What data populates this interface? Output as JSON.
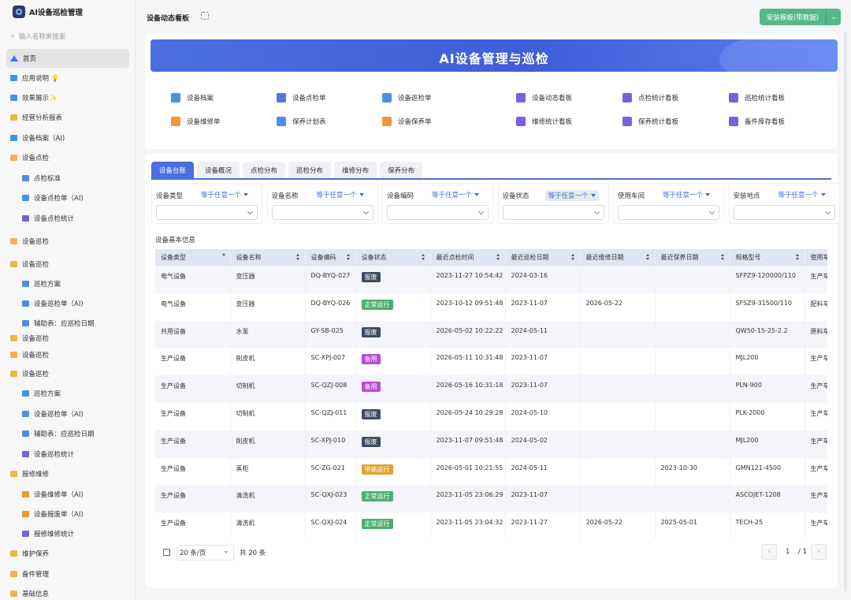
{
  "app": {
    "title": "AI设备巡检管理"
  },
  "search": {
    "placeholder": "输入名称来搜索"
  },
  "sidebar": {
    "items": [
      {
        "label": "首页"
      },
      {
        "label": "应用说明 💡"
      },
      {
        "label": "效果展示✨"
      },
      {
        "label": "经营分析报表"
      },
      {
        "label": "设备档案（AI)"
      },
      {
        "label": "设备点检"
      },
      {
        "label": "点检标准"
      },
      {
        "label": "设备点检单（AI)"
      },
      {
        "label": "设备点检统计"
      },
      {
        "label": "设备巡检"
      },
      {
        "label": "设备巡检"
      },
      {
        "label": "巡检方案"
      },
      {
        "label": "设备巡检单（AI)"
      },
      {
        "label": "辅助表：应巡检日期"
      },
      {
        "label": "设备巡检"
      },
      {
        "label": "设备巡检"
      },
      {
        "label": "设备巡检"
      },
      {
        "label": "巡检方案"
      },
      {
        "label": "设备巡检单（AI)"
      },
      {
        "label": "辅助表：应巡检日期"
      },
      {
        "label": "设备巡检统计"
      },
      {
        "label": "报修维修"
      },
      {
        "label": "设备维修单（AI)"
      },
      {
        "label": "设备报废单（AI)"
      },
      {
        "label": "报修维修统计"
      },
      {
        "label": "维护保养"
      },
      {
        "label": "备件管理"
      },
      {
        "label": "基础信息"
      }
    ]
  },
  "header": {
    "page_title": "设备动态看板",
    "install_button": "安装模板(带数据)"
  },
  "banner": {
    "title": "AI设备管理与巡检"
  },
  "quick_links": [
    {
      "label": "设备档案",
      "color": "#4a90e2"
    },
    {
      "label": "设备点检单",
      "color": "#4a7be0"
    },
    {
      "label": "设备巡检单",
      "color": "#4a90e2"
    },
    {
      "label": "设备动态看板",
      "color": "#7b5fe0"
    },
    {
      "label": "点检统计看板",
      "color": "#7b5fe0"
    },
    {
      "label": "巡检统计看板",
      "color": "#7b5fe0"
    },
    {
      "label": "设备维修单",
      "color": "#f0953a"
    },
    {
      "label": "保养计划表",
      "color": "#4a90e2"
    },
    {
      "label": "设备保养单",
      "color": "#f0953a"
    },
    {
      "label": "维修统计看板",
      "color": "#7b5fe0"
    },
    {
      "label": "保养统计看板",
      "color": "#7b5fe0"
    },
    {
      "label": "备件库存看板",
      "color": "#7b5fe0"
    }
  ],
  "tabs": [
    "设备台账",
    "设备概况",
    "点检分布",
    "巡检分布",
    "维修分布",
    "保养分布"
  ],
  "filters": [
    {
      "label": "设备类型",
      "op": "等于任意一个"
    },
    {
      "label": "设备名称",
      "op": "等于任意一个"
    },
    {
      "label": "设备编码",
      "op": "等于任意一个"
    },
    {
      "label": "设备状态",
      "op": "等于任意一个"
    },
    {
      "label": "使用车间",
      "op": "等于任意一个"
    },
    {
      "label": "安装地点",
      "op": "等于任意一个"
    }
  ],
  "table": {
    "title": "设备基本信息",
    "columns": [
      "设备类型",
      "设备名称",
      "设备编码",
      "设备状态",
      "最近点检时间",
      "最近巡检日期",
      "最近维修日期",
      "最近保养日期",
      "规格型号",
      "使用车"
    ],
    "rows": [
      [
        "电气设备",
        "变压器",
        "DQ-BYQ-027",
        "报废",
        "2023-11-27 10:54:42",
        "2024-03-16",
        "",
        "",
        "SFPZ9-120000/110",
        "生产车"
      ],
      [
        "电气设备",
        "变压器",
        "DQ-BYQ-026",
        "正常运行",
        "2023-10-12 09:51:48",
        "2023-11-07",
        "2026-05-22",
        "",
        "SFSZ9-31500/110",
        "配料车"
      ],
      [
        "共用设备",
        "水泵",
        "GY-SB-025",
        "报废",
        "2026-05-02 10:22:22",
        "2024-05-11",
        "",
        "",
        "QW50-15-25-2.2",
        "原料车"
      ],
      [
        "生产设备",
        "削皮机",
        "SC-XPJ-007",
        "备用",
        "2026-05-11 10:31:48",
        "2023-11-07",
        "",
        "",
        "MJL200",
        "生产车"
      ],
      [
        "生产设备",
        "切制机",
        "SC-QZJ-008",
        "备用",
        "2026-05-16 10:31:18",
        "2023-11-07",
        "",
        "",
        "PLN-900",
        "生产车"
      ],
      [
        "生产设备",
        "切制机",
        "SC-QZJ-011",
        "报废",
        "2026-05-24 10:29:28",
        "2024-05-10",
        "",
        "",
        "PLK-2000",
        "生产车"
      ],
      [
        "生产设备",
        "削皮机",
        "SC-XPJ-010",
        "报废",
        "2023-11-07 09:51:48",
        "2024-05-02",
        "",
        "",
        "MJL200",
        "生产车"
      ],
      [
        "生产设备",
        "蒸柜",
        "SC-ZG-021",
        "带病运行",
        "2026-05-01 10:21:55",
        "2024-05-11",
        "",
        "2023-10-30",
        "GMN121-4500",
        "生产车"
      ],
      [
        "生产设备",
        "清洗机",
        "SC-QXJ-023",
        "正常运行",
        "2023-11-05 23:06:29",
        "2023-11-07",
        "",
        "",
        "ASCOJET-1208",
        "生产车"
      ],
      [
        "生产设备",
        "清洗机",
        "SC-QXJ-024",
        "正常运行",
        "2023-11-05 23:04:32",
        "2023-11-27",
        "2026-05-22",
        "2025-05-01",
        "TECH-25",
        "生产车"
      ]
    ],
    "status_colors": {
      "报废": "#3d4a63",
      "正常运行": "#4cae6e",
      "备用": "#b94ad6",
      "带病运行": "#e0a233"
    }
  },
  "pager": {
    "page_size": "20 条/页",
    "total": "共 20 条",
    "current": "1",
    "of": "/ 1",
    "prev": "‹",
    "next": "›"
  }
}
